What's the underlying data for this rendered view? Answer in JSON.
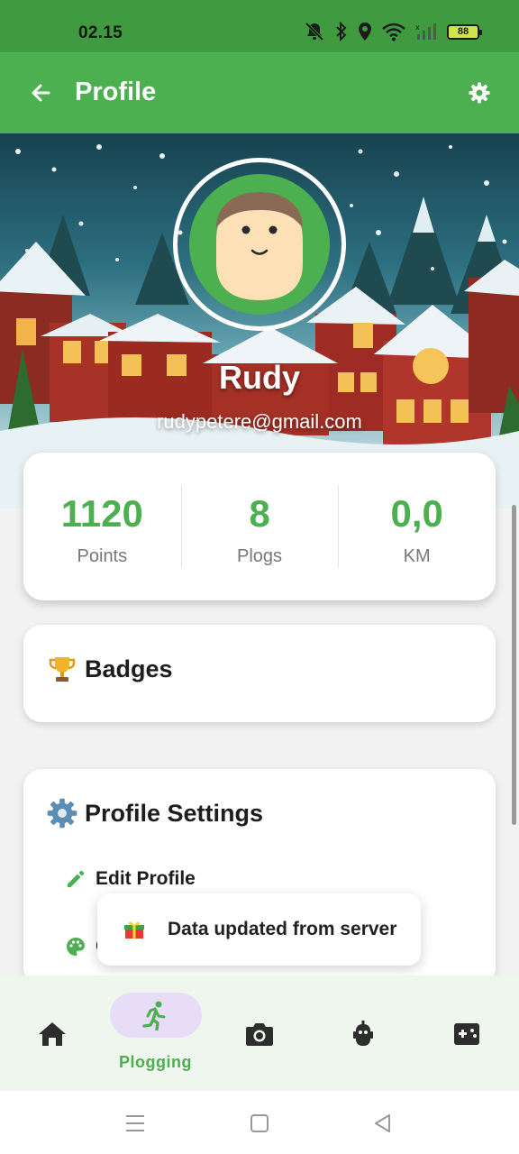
{
  "status_bar": {
    "time": "02.15",
    "battery_level": "88",
    "icons": [
      "mute-icon",
      "bluetooth-icon",
      "location-icon",
      "wifi-icon",
      "signal-icon",
      "battery-icon"
    ]
  },
  "app_bar": {
    "title": "Profile",
    "back_icon": "arrow-back-icon",
    "settings_icon": "gear-icon"
  },
  "profile": {
    "name": "Rudy",
    "email": "rudypetere@gmail.com"
  },
  "stats": [
    {
      "value": "1120",
      "label": "Points"
    },
    {
      "value": "8",
      "label": "Plogs"
    },
    {
      "value": "0,0",
      "label": "KM"
    }
  ],
  "badges": {
    "icon": "trophy-icon",
    "title": "Badges"
  },
  "profile_settings": {
    "icon": "gear-icon",
    "title": "Profile Settings",
    "items": [
      {
        "icon": "pencil-icon",
        "label": "Edit Profile"
      },
      {
        "icon": "palette-icon",
        "label": "C"
      }
    ]
  },
  "toast": {
    "icon": "gift-icon",
    "message": "Data updated from server"
  },
  "bottom_nav": {
    "items": [
      {
        "icon": "home-icon",
        "label": ""
      },
      {
        "icon": "running-icon",
        "label": "Plogging",
        "active": true
      },
      {
        "icon": "camera-icon",
        "label": ""
      },
      {
        "icon": "robot-icon",
        "label": ""
      },
      {
        "icon": "gamepad-icon",
        "label": ""
      }
    ]
  },
  "colors": {
    "primary": "#4caf50",
    "status_bar": "#3f9a40",
    "active_pill": "#e8ddf7"
  }
}
